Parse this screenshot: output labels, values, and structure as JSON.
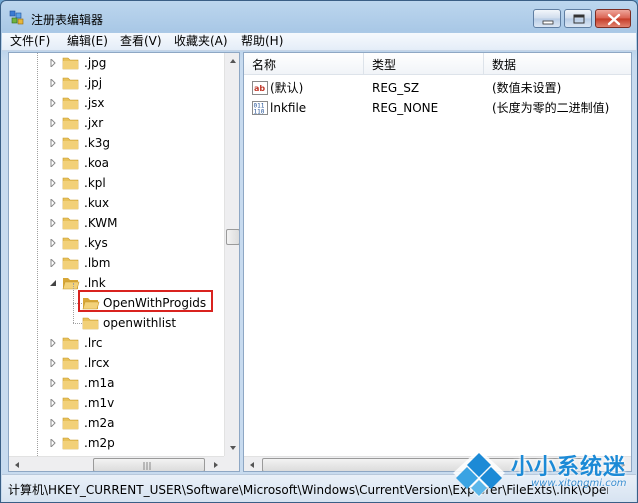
{
  "window": {
    "title": "注册表编辑器",
    "controls": {
      "minimize": "minimize-icon",
      "maximize": "maximize-icon",
      "close": "close-icon"
    }
  },
  "menu": [
    "文件(F)",
    "编辑(E)",
    "查看(V)",
    "收藏夹(A)",
    "帮助(H)"
  ],
  "tree": {
    "items": [
      {
        "label": ".jpg",
        "expanded": false
      },
      {
        "label": ".jpj",
        "expanded": false
      },
      {
        "label": ".jsx",
        "expanded": false
      },
      {
        "label": ".jxr",
        "expanded": false
      },
      {
        "label": ".k3g",
        "expanded": false
      },
      {
        "label": ".koa",
        "expanded": false
      },
      {
        "label": ".kpl",
        "expanded": false
      },
      {
        "label": ".kux",
        "expanded": false
      },
      {
        "label": ".KWM",
        "expanded": false
      },
      {
        "label": ".kys",
        "expanded": false
      },
      {
        "label": ".lbm",
        "expanded": false
      },
      {
        "label": ".lnk",
        "expanded": true
      },
      {
        "label": "OpenWithProgids",
        "child": true,
        "selected": true
      },
      {
        "label": "openwithlist",
        "child": true
      },
      {
        "label": ".lrc",
        "expanded": false
      },
      {
        "label": ".lrcx",
        "expanded": false
      },
      {
        "label": ".m1a",
        "expanded": false
      },
      {
        "label": ".m1v",
        "expanded": false
      },
      {
        "label": ".m2a",
        "expanded": false
      },
      {
        "label": ".m2p",
        "expanded": false
      }
    ]
  },
  "values": {
    "headers": {
      "name": "名称",
      "type": "类型",
      "data": "数据"
    },
    "rows": [
      {
        "icon": "string-value-icon",
        "name": "(默认)",
        "type": "REG_SZ",
        "data": "(数值未设置)"
      },
      {
        "icon": "binary-value-icon",
        "name": "lnkfile",
        "type": "REG_NONE",
        "data": "(长度为零的二进制值)"
      }
    ]
  },
  "status": {
    "path": "计算机\\HKEY_CURRENT_USER\\Software\\Microsoft\\Windows\\CurrentVersion\\Explorer\\FileExts\\.lnk\\OpenWithProgids"
  },
  "watermark": {
    "brand": "小小系统迷",
    "url": "www.xitongmi.com"
  },
  "colors": {
    "highlight_border": "#d9231f",
    "folder": "#e8c15a",
    "watermark": "#1c8ad6"
  }
}
